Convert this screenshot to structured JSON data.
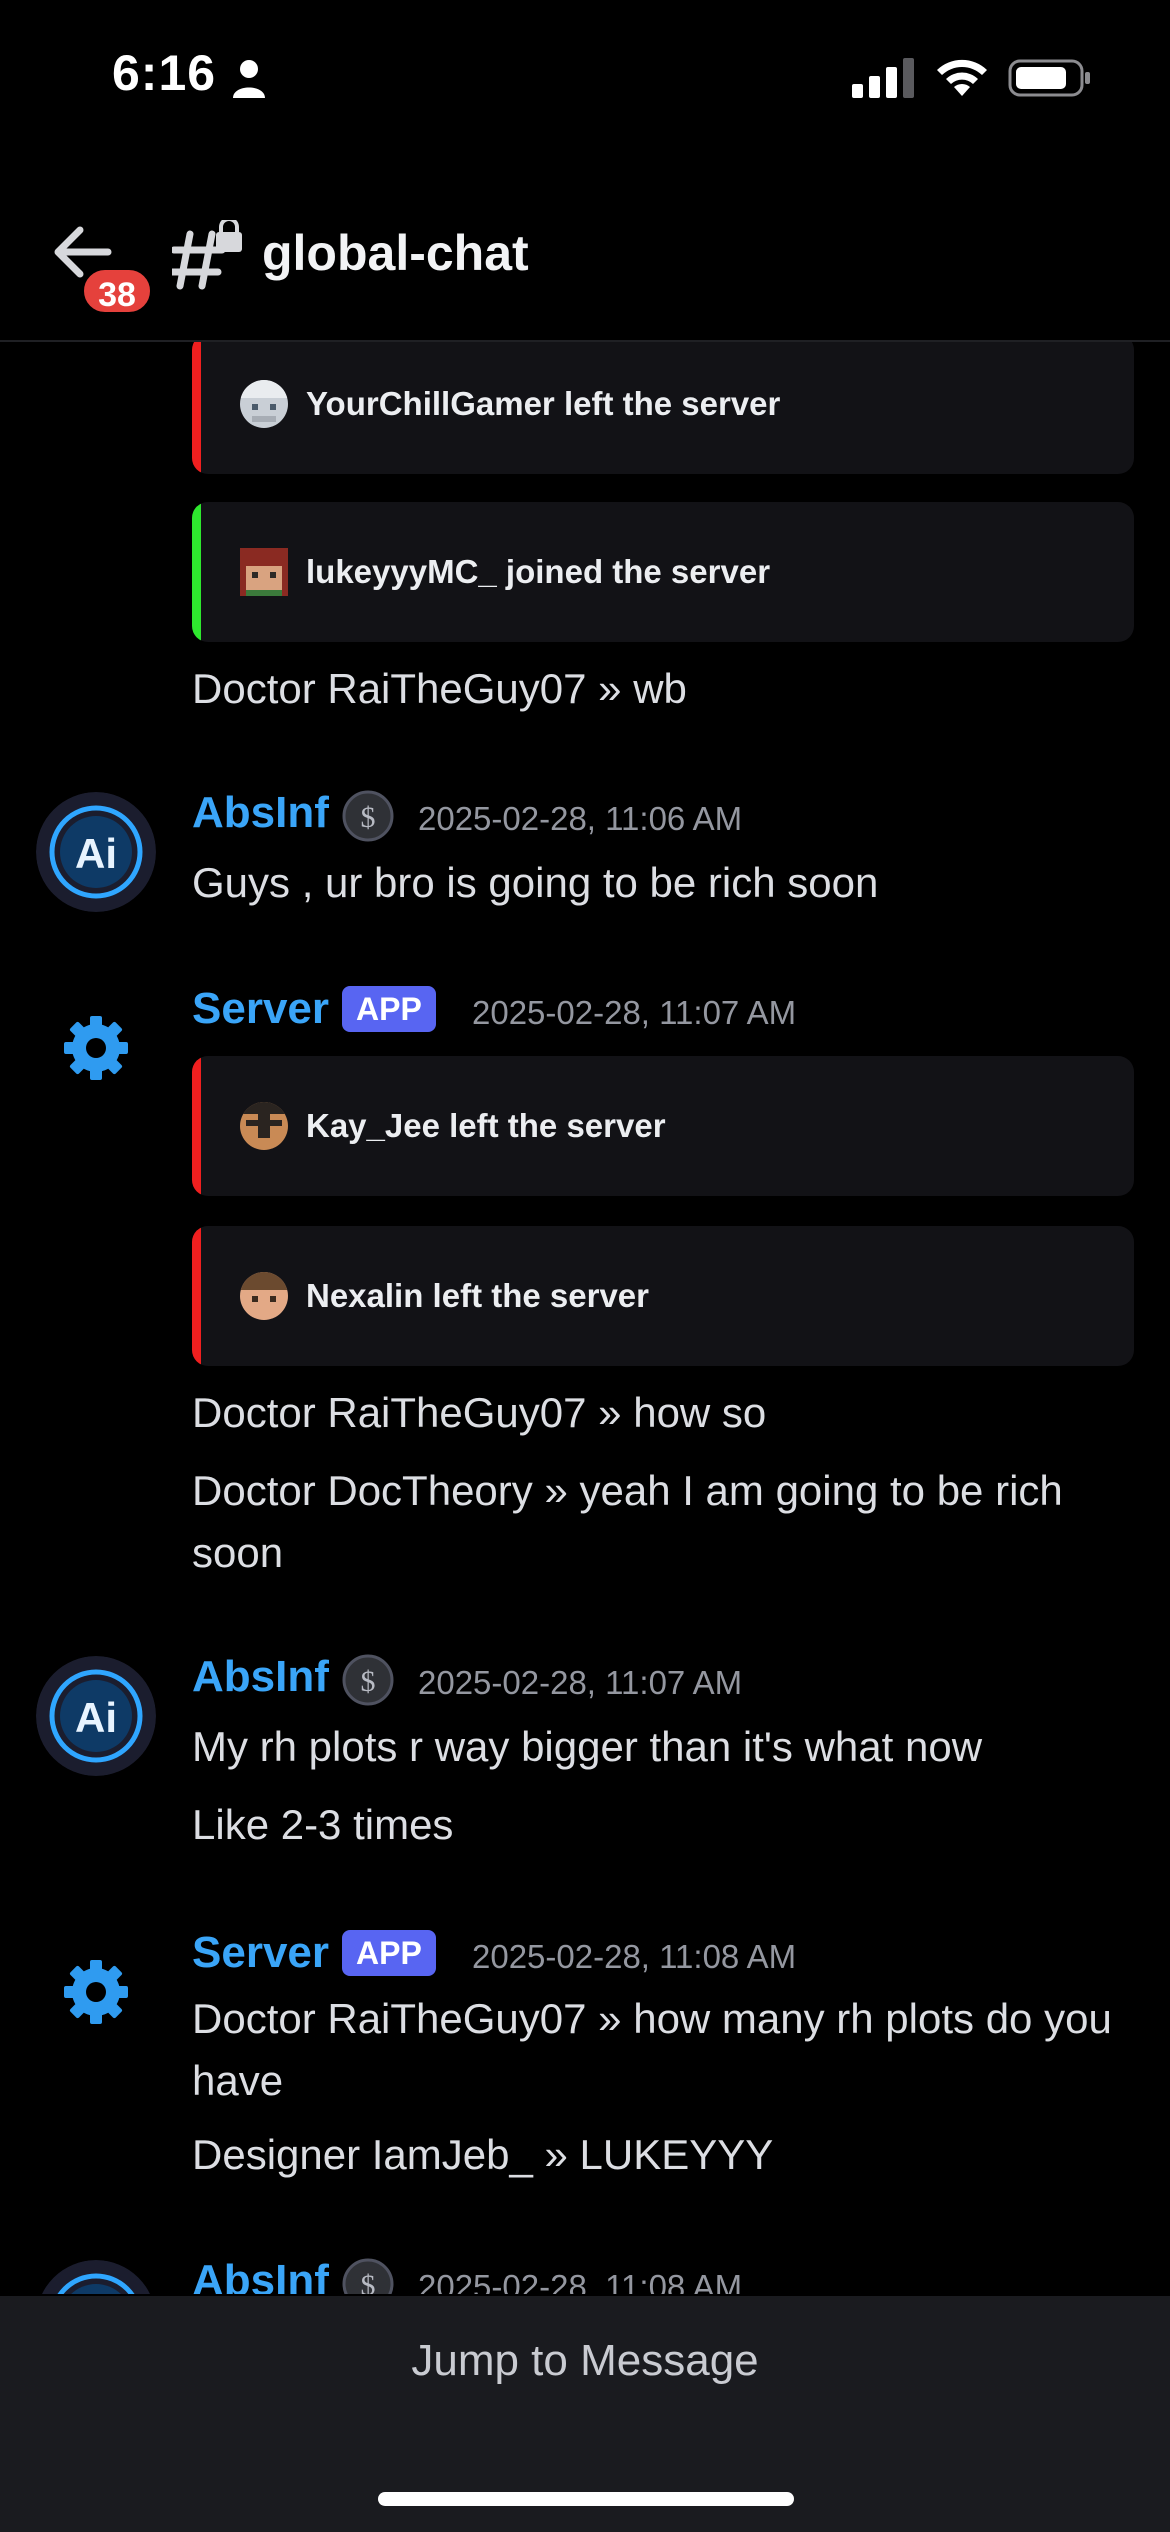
{
  "status_bar": {
    "time": "6:16"
  },
  "header": {
    "back_badge": "38",
    "channel_name": "global-chat"
  },
  "colors": {
    "accent_blue": "#3aa5f8",
    "left_red": "#f01f1f",
    "joined_green": "#2ee82e",
    "app_tag": "#5865f2"
  },
  "messages": {
    "embed_left_1": "YourChillGamer left the server",
    "embed_joined_1": "lukeyyyMC_ joined the server",
    "line_wb": "Doctor RaiTheGuy07 » wb",
    "absinf_1": {
      "author": "AbsInf",
      "timestamp": "2025-02-28, 11:06 AM",
      "text": "Guys , ur bro is going to be rich soon"
    },
    "server_1": {
      "author": "Server",
      "tag": "APP",
      "timestamp": "2025-02-28, 11:07 AM",
      "embed_left_2": "Kay_Jee left the server",
      "embed_left_3": "Nexalin left the server",
      "line_1": "Doctor RaiTheGuy07 » how so",
      "line_2": "Doctor DocTheory » yeah I am going to be rich soon"
    },
    "absinf_2": {
      "author": "AbsInf",
      "timestamp": "2025-02-28, 11:07 AM",
      "text_1": "My rh plots r way bigger than it's what now",
      "text_2": "Like 2-3 times"
    },
    "server_2": {
      "author": "Server",
      "tag": "APP",
      "timestamp": "2025-02-28, 11:08 AM",
      "line_1": "Doctor RaiTheGuy07 » how many rh plots do you have",
      "line_2": "Designer IamJeb_ » LUKEYYY"
    },
    "absinf_3": {
      "author": "AbsInf",
      "timestamp": "2025-02-28, 11:08 AM"
    }
  },
  "bottom": {
    "jump_label": "Jump to Message"
  }
}
